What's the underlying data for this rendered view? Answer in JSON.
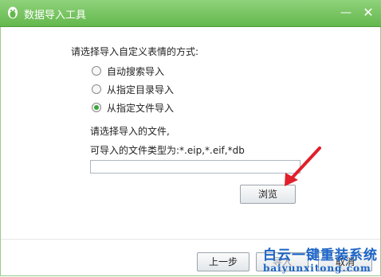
{
  "window": {
    "title": "数据导入工具",
    "minimize_glyph": "—",
    "close_glyph": "✕"
  },
  "question": "请选择导入自定义表情的方式:",
  "options": [
    {
      "label": "自动搜索导入",
      "selected": false
    },
    {
      "label": "从指定目录导入",
      "selected": false
    },
    {
      "label": "从指定文件导入",
      "selected": true
    }
  ],
  "file_section": {
    "hint": "请选择导入的文件,",
    "types": "可导入的文件类型为:*.eip,*.eif,*db",
    "path_value": "",
    "browse_label": "浏览"
  },
  "footer": {
    "prev_label": "上一步",
    "next_label": "导入",
    "cancel_label": "取消"
  },
  "watermark": {
    "text_cn": "白云一键重装系统",
    "url": "baiyunxitong.com"
  },
  "colors": {
    "titlebar": "#63b84d",
    "radio_selected": "#3aa53a",
    "arrow": "#e0202a",
    "watermark": "#1b63c6"
  },
  "icons": [
    "penguin-icon",
    "minimize-icon",
    "close-icon",
    "arrow-annotation"
  ]
}
